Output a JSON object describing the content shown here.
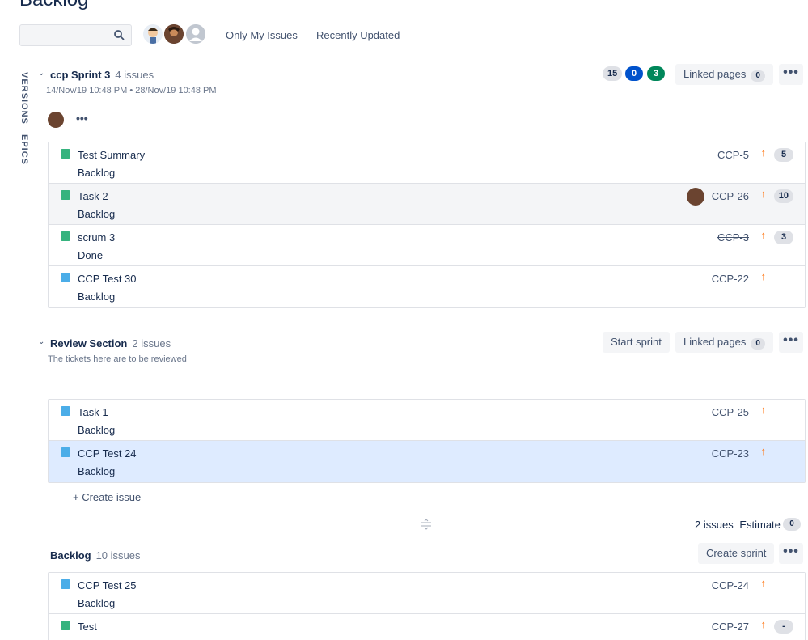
{
  "page": {
    "title": "Backlog"
  },
  "toolbar": {
    "search_placeholder": "",
    "filters": [
      "Only My Issues",
      "Recently Updated"
    ]
  },
  "sidebar": {
    "tabs": [
      "VERSIONS",
      "EPICS"
    ]
  },
  "sprint": {
    "name": "ccp Sprint 3",
    "count": "4 issues",
    "dates": "14/Nov/19 10:48 PM • 28/Nov/19 10:48 PM",
    "badges": [
      "15",
      "0",
      "3"
    ],
    "linked_pages_label": "Linked pages",
    "linked_pages_count": "0",
    "more": "•••",
    "issues": [
      {
        "title": "Test Summary",
        "status": "Backlog",
        "key": "CCP-5",
        "estimate": "5",
        "type": "story"
      },
      {
        "title": "Task 2",
        "status": "Backlog",
        "key": "CCP-26",
        "estimate": "10",
        "type": "story"
      },
      {
        "title": "scrum 3",
        "status": "Done",
        "key": "CCP-3",
        "estimate": "3",
        "type": "story"
      },
      {
        "title": "CCP Test 30",
        "status": "Backlog",
        "key": "CCP-22",
        "estimate": "",
        "type": "task"
      }
    ]
  },
  "review": {
    "name": "Review Section",
    "count": "2 issues",
    "subtitle": "The tickets here are to be reviewed",
    "start_sprint": "Start sprint",
    "linked_pages_label": "Linked pages",
    "linked_pages_count": "0",
    "issues": [
      {
        "title": "Task 1",
        "status": "Backlog",
        "key": "CCP-25",
        "type": "task"
      },
      {
        "title": "CCP Test 24",
        "status": "Backlog",
        "key": "CCP-23",
        "type": "task"
      }
    ],
    "create_issue": "+  Create issue",
    "footer_count": "2 issues",
    "footer_estimate_label": "Estimate",
    "footer_estimate": "0"
  },
  "backlog": {
    "name": "Backlog",
    "count": "10 issues",
    "create_sprint": "Create sprint",
    "issues": [
      {
        "title": "CCP Test 25",
        "status": "Backlog",
        "key": "CCP-24",
        "type": "task"
      },
      {
        "title": "Test",
        "status": "",
        "key": "CCP-27",
        "estimate": "-",
        "type": "story"
      }
    ]
  },
  "priority_glyph": "↑",
  "colors": {
    "accent_blue": "#0052cc",
    "green": "#00875a",
    "priority": "#ff7a1a",
    "selected": "#deebff"
  }
}
